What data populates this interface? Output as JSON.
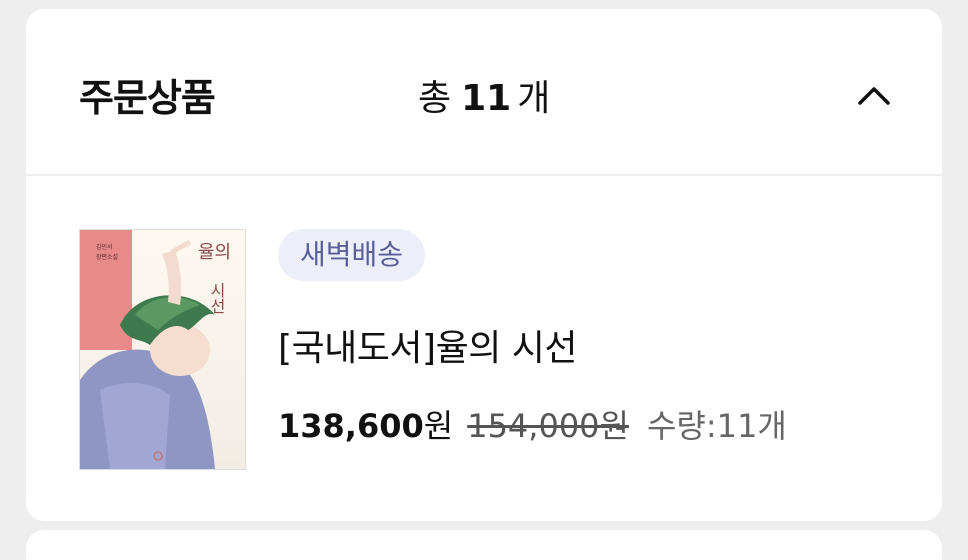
{
  "header": {
    "title": "주문상품",
    "count_prefix": "총",
    "count_value": "11",
    "count_unit": "개"
  },
  "product": {
    "badge": "새벽배송",
    "name": "[국내도서]율의 시선",
    "sale_price": "138,600",
    "sale_unit": "원",
    "original_price": "154,000원",
    "quantity": "수량:11개",
    "cover": {
      "title_line1": "율의",
      "title_line2": "시선",
      "author_line1": "김민서",
      "author_line2": "장편소설"
    }
  },
  "icons": {
    "collapse": "chevron-up-icon"
  },
  "colors": {
    "background": "#eeeeee",
    "badge_bg": "#eceef9",
    "badge_text": "#5a5f9a"
  }
}
